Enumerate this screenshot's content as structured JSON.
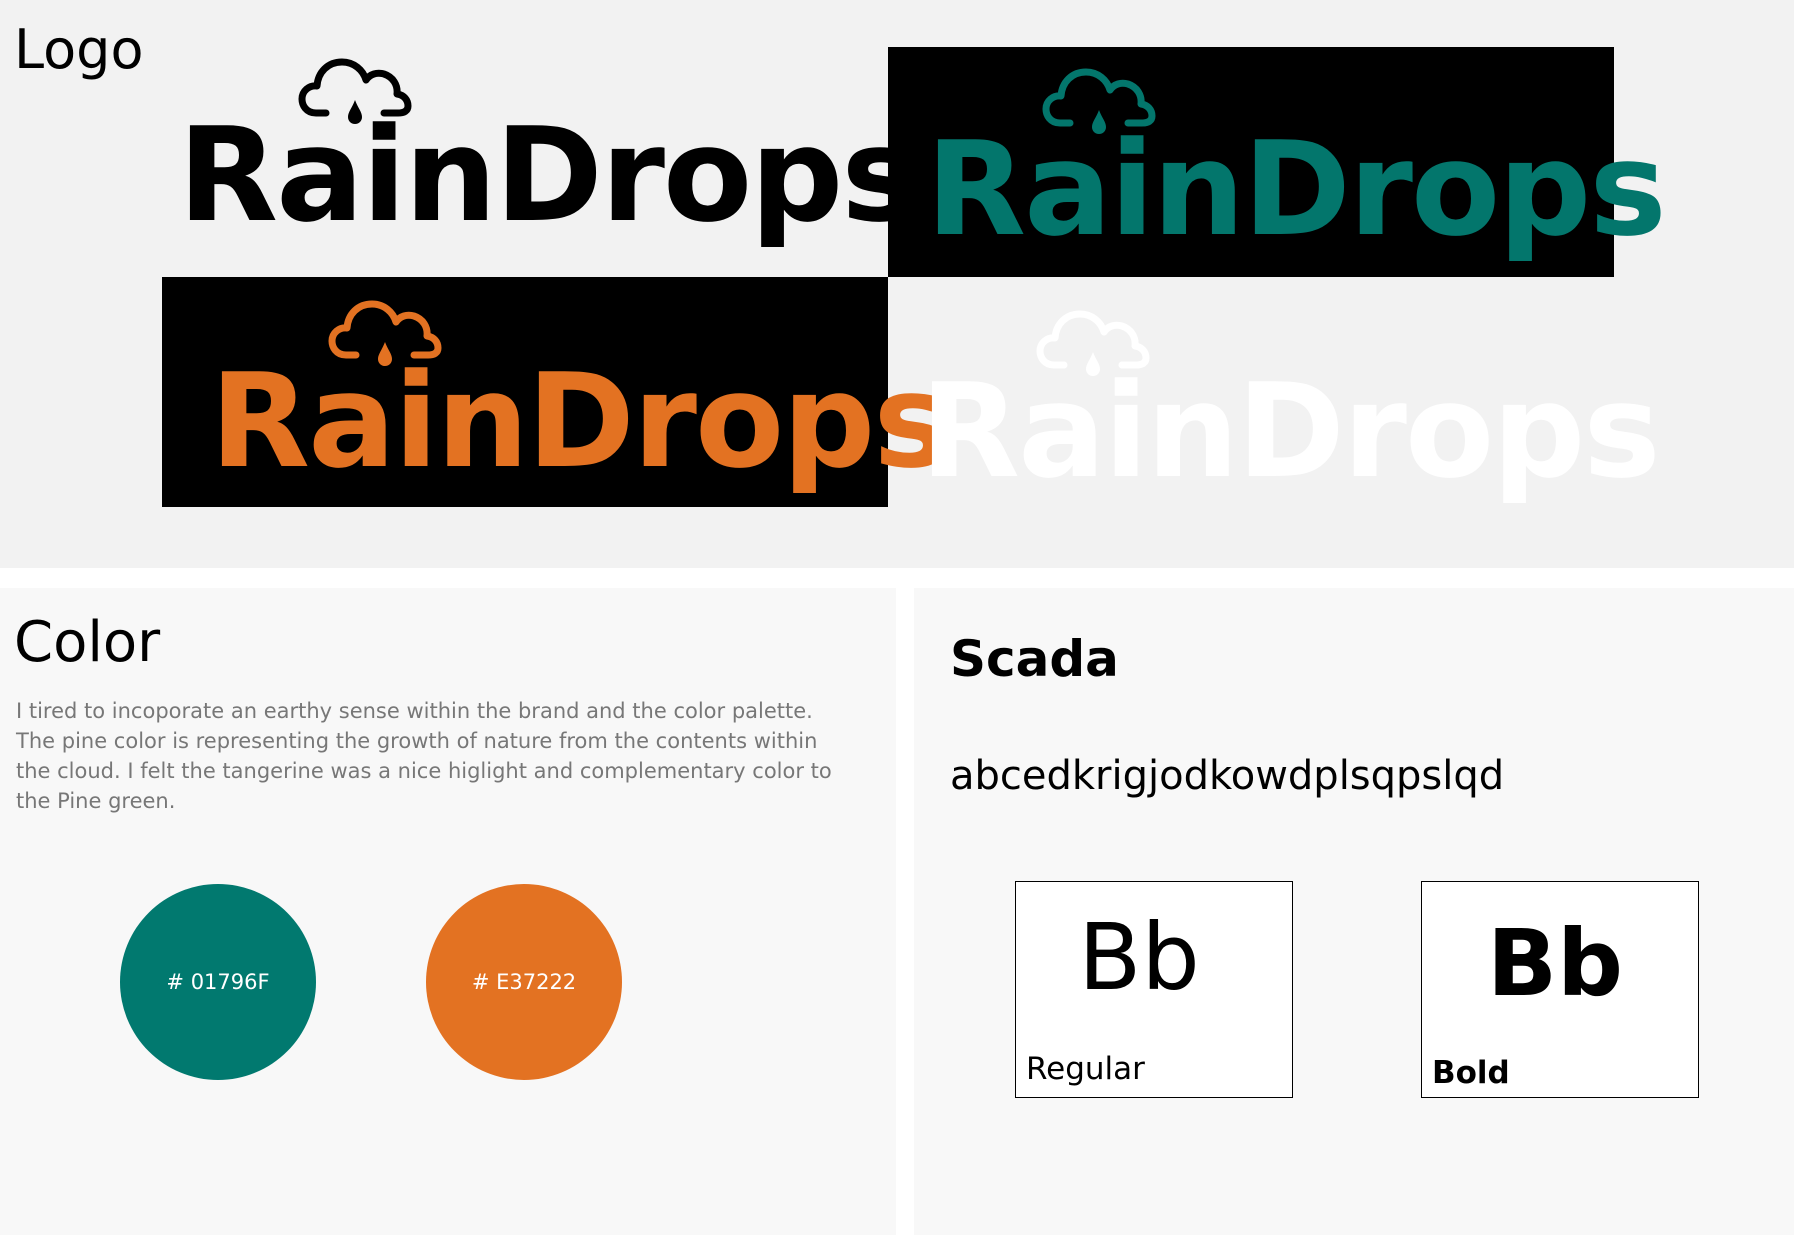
{
  "logo_section": {
    "heading": "Logo",
    "wordmark": "RainDrops",
    "variants": [
      {
        "id": "black-on-light",
        "text_color": "#000000",
        "background": "#f2f2f2"
      },
      {
        "id": "pine-on-black",
        "text_color": "#01796F",
        "background": "#000000"
      },
      {
        "id": "tangerine-on-black",
        "text_color": "#E37222",
        "background": "#000000"
      },
      {
        "id": "white-on-light",
        "text_color": "#ffffff",
        "background": "#f2f2f2"
      }
    ],
    "icon": "cloud-raindrop-icon"
  },
  "color_section": {
    "heading": "Color",
    "description": "I tired to incoporate an earthy sense within the brand and the color palette. The pine color is representing the growth of nature from the contents within the cloud. I felt the tangerine was a nice higlight and complementary  color to the Pine green.",
    "swatches": [
      {
        "label": "# 01796F",
        "hex": "#01796F"
      },
      {
        "label": "# E37222",
        "hex": "#E37222"
      }
    ]
  },
  "typography_section": {
    "heading": "Scada",
    "sample": "abcedkrigjodkowdplsqpslqd",
    "weights": [
      {
        "glyphs": "Bb",
        "label": "Regular"
      },
      {
        "glyphs": "Bb",
        "label": "Bold"
      }
    ]
  }
}
